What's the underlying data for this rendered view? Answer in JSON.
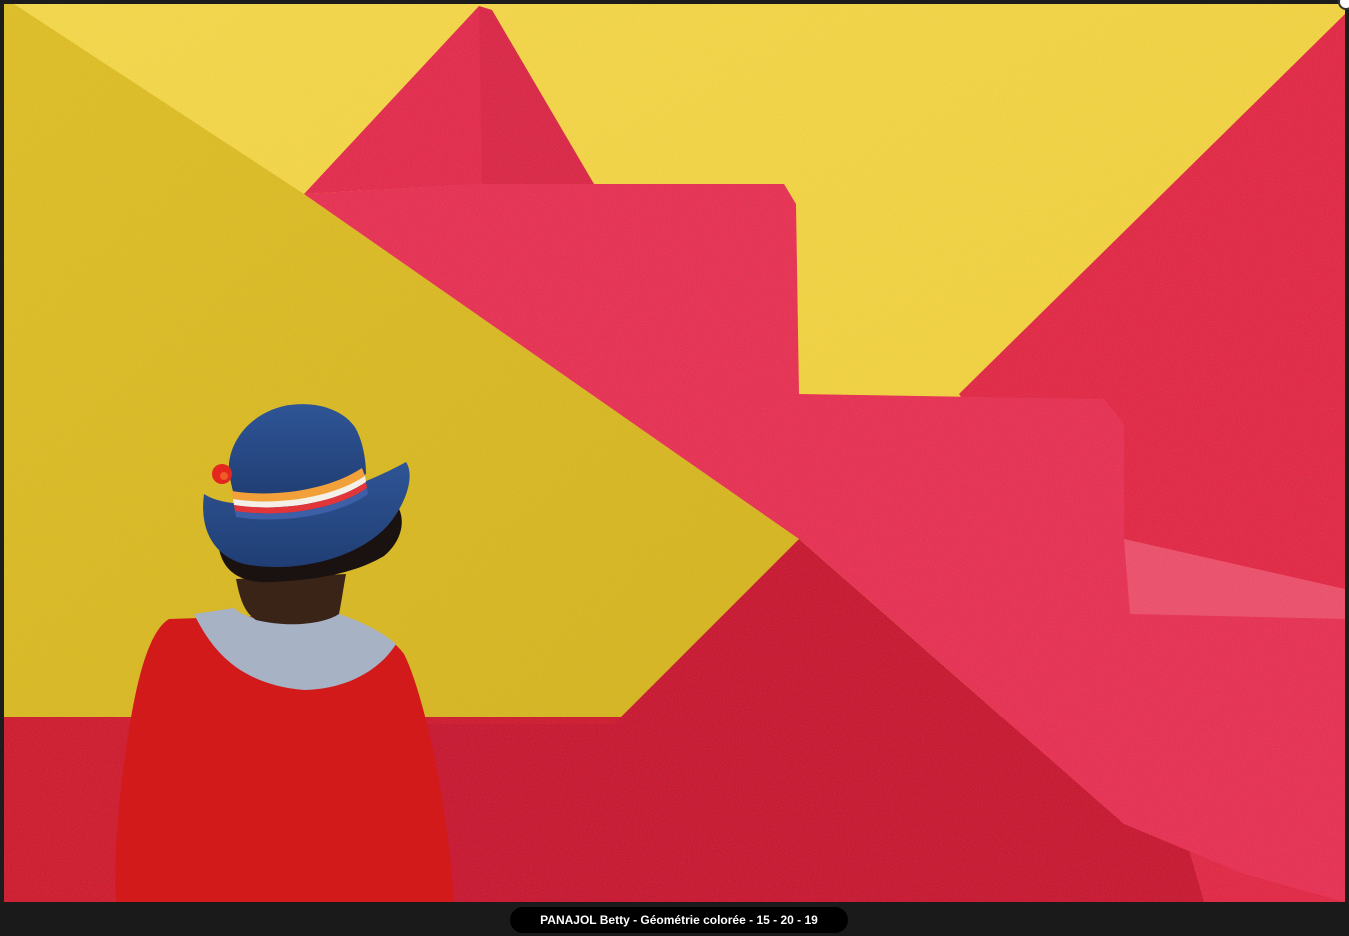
{
  "caption": {
    "text": "PANAJOL Betty - Géométrie colorée - 15 - 20 - 19"
  },
  "photo": {
    "subject": "photograph",
    "colors": {
      "yellow_bright": "#f6d43c",
      "yellow_shadow": "#d9b81c",
      "red_bright": "#ea2a4f",
      "red_shadow": "#c8102a",
      "hat_blue": "#2b4d8a",
      "sweater_red": "#d41a1a",
      "shirt_grey": "#a9b4c6",
      "hair": "#1a1210"
    }
  },
  "icons": {
    "close": "close-icon"
  }
}
